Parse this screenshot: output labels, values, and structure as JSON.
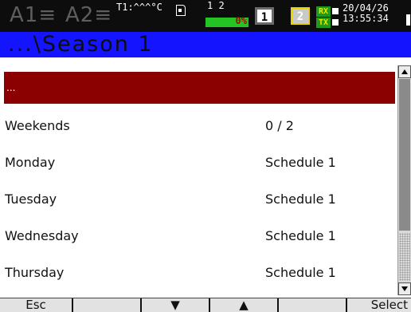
{
  "status_bar": {
    "alarm_1": "A1≡",
    "alarm_2": "A2≡",
    "temperature": "T1:^^^°C",
    "channels": "1 2",
    "memory_used": "0%",
    "group_1": "1",
    "group_2": "2",
    "rx": "RX",
    "tx": "TX",
    "date": "20/04/26",
    "time": "13:55:34"
  },
  "title": "...\\Season 1",
  "list": {
    "items": [
      {
        "label": "...",
        "value": ""
      },
      {
        "label": "Weekends",
        "value": "0 / 2"
      },
      {
        "label": "Monday",
        "value": "Schedule 1"
      },
      {
        "label": "Tuesday",
        "value": "Schedule 1"
      },
      {
        "label": "Wednesday",
        "value": "Schedule 1"
      },
      {
        "label": "Thursday",
        "value": "Schedule 1"
      }
    ]
  },
  "softkeys": {
    "k1": "Esc",
    "k2": "",
    "k3": "▼",
    "k4": "▲",
    "k5": "",
    "k6": "Select"
  },
  "colors": {
    "status_bg": "#0d0d0d",
    "title_bg": "#1414ff",
    "selection_bg": "#8b0000",
    "memory_bar": "#23c423"
  }
}
